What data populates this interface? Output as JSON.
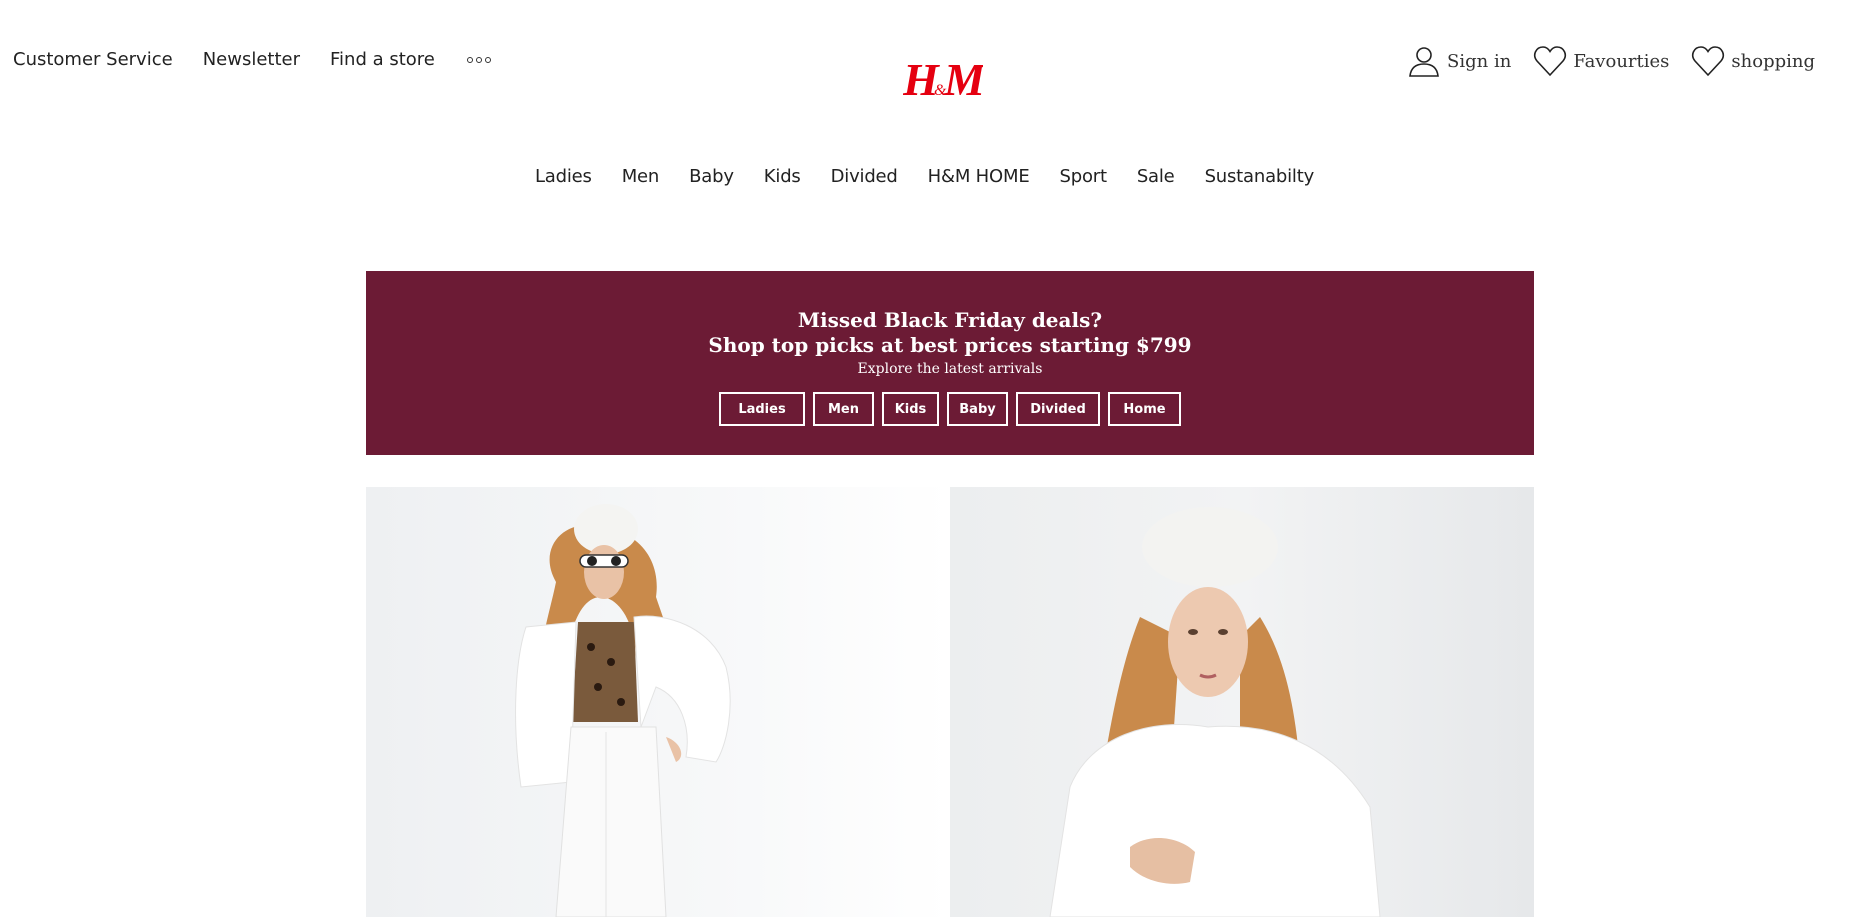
{
  "utility_nav": {
    "customer_service": "Customer Service",
    "newsletter": "Newsletter",
    "find_store": "Find a store",
    "more_icon": "more-dots-icon"
  },
  "brand": {
    "logo_text": "H&M",
    "logo_color": "#e50010"
  },
  "account": {
    "sign_in": "Sign in",
    "favourites": "Favourties",
    "shopping": "shopping"
  },
  "main_nav": [
    "Ladies",
    "Men",
    "Baby",
    "Kids",
    "Divided",
    "H&M HOME",
    "Sport",
    "Sale",
    "Sustanabilty"
  ],
  "promo": {
    "headline": "Missed Black Friday deals?",
    "subheadline": "Shop top picks at best prices starting $799",
    "caption": "Explore the latest arrivals",
    "buttons": [
      "Ladies",
      "Men",
      "Kids",
      "Baby",
      "Divided",
      "Home"
    ],
    "background_color": "#6c1b35"
  },
  "hero": {
    "panels": [
      "model-white-faux-fur-jacket-sunglasses",
      "model-white-faux-fur-coat-hat"
    ]
  }
}
